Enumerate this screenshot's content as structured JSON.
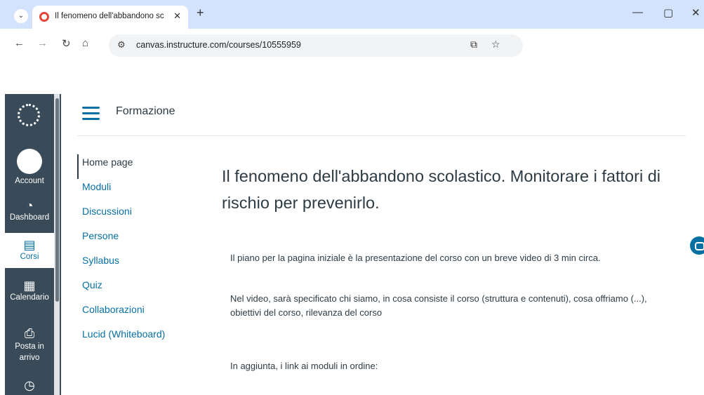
{
  "browser": {
    "tab_list_icon": "chevron-down-icon",
    "tab_title": "Il fenomeno dell'abbandono sc",
    "tab_close": "✕",
    "new_tab": "+",
    "minimize": "—",
    "maximize": "▢",
    "close": "✕",
    "url": "canvas.instructure.com/courses/10555959"
  },
  "global_nav": {
    "items": [
      {
        "label": "Account",
        "icon": "avatar"
      },
      {
        "label": "Dashboard",
        "icon": "dashboard-icon"
      },
      {
        "label": "Corsi",
        "icon": "courses-icon"
      },
      {
        "label": "Calendario",
        "icon": "calendar-icon"
      },
      {
        "label": "Posta in arrivo",
        "icon": "inbox-icon"
      },
      {
        "label": "",
        "icon": "history-icon"
      }
    ]
  },
  "header": {
    "breadcrumb": "Formazione"
  },
  "course_nav": {
    "items": [
      "Home page",
      "Moduli",
      "Discussioni",
      "Persone",
      "Syllabus",
      "Quiz",
      "Collaborazioni",
      "Lucid (Whiteboard)"
    ],
    "active": "Home page"
  },
  "page": {
    "title": "Il fenomeno dell'abbandono scolastico. Monitorare i fattori di rischio per prevenirlo.",
    "paragraphs": [
      "Il piano per la pagina iniziale è la presentazione del corso con un breve video di 3 min circa.",
      "Nel video, sarà specificato chi siamo, in cosa consiste il corso (struttura e contenuti), cosa offriamo (...), obiettivi del corso, rilevanza del corso",
      "In aggiunta, i link ai moduli in ordine:"
    ]
  },
  "colors": {
    "nav_bg": "#394b58",
    "link": "#0770a3",
    "text": "#2d3b45",
    "chrome_tabbar": "#d3e3fd"
  }
}
